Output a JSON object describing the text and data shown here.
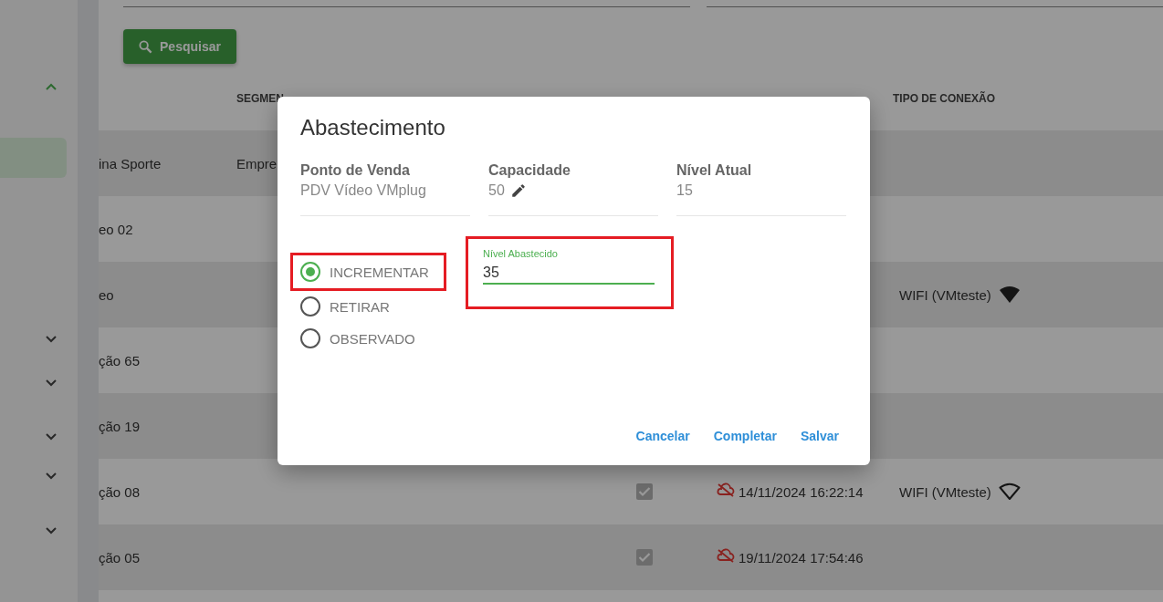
{
  "sidebar": {
    "toggles": [
      {
        "expanded": true
      },
      {
        "expanded": false
      },
      {
        "expanded": false
      },
      {
        "expanded": false
      },
      {
        "expanded": false
      },
      {
        "expanded": false
      }
    ]
  },
  "search_button": {
    "label": "Pesquisar"
  },
  "table": {
    "columns": [
      {
        "label": "SEGMEN"
      },
      {
        "label": "TIPO DE CONEXÃO"
      }
    ],
    "rows": [
      {
        "name": "ina Sporte",
        "segment": "Empre"
      },
      {
        "name": "eo 02"
      },
      {
        "name": "eo",
        "connection": "WIFI (VMteste)",
        "signal": {
          "kind": "filled"
        }
      },
      {
        "name": "ção 65"
      },
      {
        "name": "ção 19"
      },
      {
        "name": "ção 08",
        "checked": true,
        "synced": false,
        "date": "14/11/2024 16:22:14",
        "connection": "WIFI (VMteste)",
        "signal": {
          "kind": "outline"
        }
      },
      {
        "name": "ção 05",
        "checked": true,
        "synced": false,
        "date": "19/11/2024 17:54:46"
      }
    ]
  },
  "dialog": {
    "title": "Abastecimento",
    "info": [
      {
        "label": "Ponto de Venda",
        "value": "PDV Vídeo VMplug",
        "editable": false
      },
      {
        "label": "Capacidade",
        "value": "50",
        "editable": true
      },
      {
        "label": "Nível Atual",
        "value": "15",
        "editable": false
      }
    ],
    "options": [
      {
        "label": "INCREMENTAR",
        "selected": true
      },
      {
        "label": "RETIRAR",
        "selected": false
      },
      {
        "label": "OBSERVADO",
        "selected": false
      }
    ],
    "field": {
      "label": "Nível Abastecido",
      "value": "35",
      "focused": true
    },
    "actions": [
      {
        "label": "Cancelar"
      },
      {
        "label": "Completar"
      },
      {
        "label": "Salvar"
      }
    ]
  }
}
